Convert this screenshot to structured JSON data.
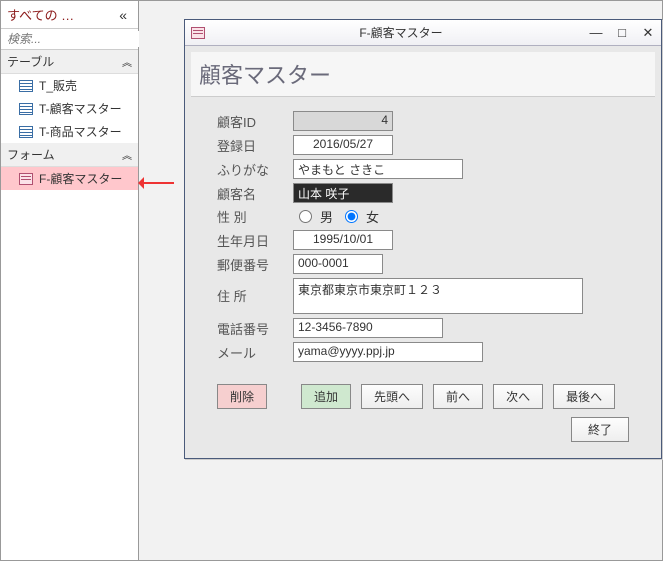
{
  "nav": {
    "title": "すべての …",
    "search_placeholder": "検索...",
    "groups": [
      {
        "label": "テーブル",
        "items": [
          {
            "label": "T_販売",
            "type": "table"
          },
          {
            "label": "T-顧客マスター",
            "type": "table"
          },
          {
            "label": "T-商品マスター",
            "type": "table"
          }
        ]
      },
      {
        "label": "フォーム",
        "items": [
          {
            "label": "F-顧客マスター",
            "type": "form",
            "selected": true
          }
        ]
      }
    ]
  },
  "form_window": {
    "title": "F-顧客マスター",
    "heading": "顧客マスター",
    "fields": {
      "id_label": "顧客ID",
      "id_value": "4",
      "regdate_label": "登録日",
      "regdate_value": "2016/05/27",
      "kana_label": "ふりがな",
      "kana_value": "やまもと さきこ",
      "name_label": "顧客名",
      "name_value": "山本  咲子",
      "sex_label": "性 別",
      "sex_m": "男",
      "sex_f": "女",
      "sex_selected": "女",
      "birth_label": "生年月日",
      "birth_value": "1995/10/01",
      "zip_label": "郵便番号",
      "zip_value": "000-0001",
      "addr_label": "住 所",
      "addr_value": "東京都東京市東京町１２３",
      "tel_label": "電話番号",
      "tel_value": "12-3456-7890",
      "mail_label": "メール",
      "mail_value": "yama@yyyy.ppj.jp"
    },
    "buttons": {
      "delete": "削除",
      "add": "追加",
      "first": "先頭へ",
      "prev": "前へ",
      "next": "次へ",
      "last": "最後へ",
      "end": "終了"
    }
  }
}
